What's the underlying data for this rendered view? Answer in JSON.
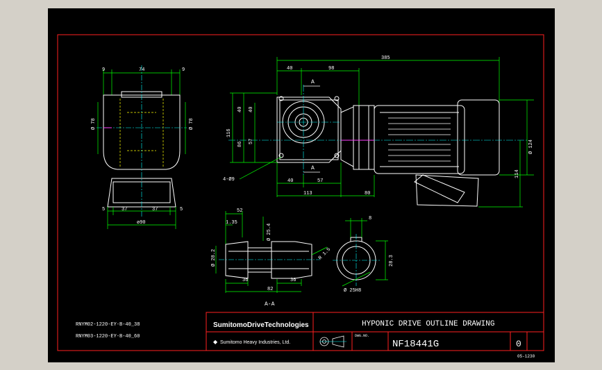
{
  "colors": {
    "frame": "#ff2020",
    "outline": "#ffffff",
    "dimension": "#00ff00",
    "centerline": "#00ffff",
    "hidden": "#ffff00",
    "text": "#ffffff",
    "magenta": "#ff40ff",
    "background": "#000000"
  },
  "left_view": {
    "dims_top": [
      "9",
      "74",
      "9"
    ],
    "dim_left": "Ø 78",
    "dim_right": "Ø 78",
    "dims_bottom": [
      "5",
      "37",
      "37",
      "5"
    ],
    "dim_base": "ø90"
  },
  "main_view": {
    "dim_overall": "385",
    "dims_top": [
      "40",
      "98"
    ],
    "section_mark_top": "A",
    "section_mark_bottom": "A",
    "dims_left": [
      "116",
      "40",
      "40",
      "86",
      "57"
    ],
    "hole_note": "4-Ø9",
    "dims_bottom": [
      "40",
      "57",
      "113",
      "80"
    ],
    "dim_motor_dia": "Ø 124",
    "dim_height": "114"
  },
  "section_view": {
    "dims_top": [
      "52",
      "1.35"
    ],
    "dim_bore": "Ø 25.4",
    "dim_left": "Ø 28.2",
    "dim_chamfer": "R 1.5",
    "dims_bottom": [
      "36",
      "36",
      "82"
    ],
    "caption": "A-A",
    "key_width": "8",
    "key_depth": "28.3",
    "shaft_dia": "Ø 25H8"
  },
  "notes": {
    "model_1": "RNYM02-1220-EY-B-40_38",
    "model_2": "RNYM03-1220-EY-B-40_60"
  },
  "title_block": {
    "brand": "SumitomoDriveTechnologies",
    "company": "Sumitomo Heavy Industries, Ltd.",
    "title": "HYPONIC DRIVE OUTLINE DRAWING",
    "drawing_no_label": "DWG.NO.",
    "drawing_no": "NF18441G",
    "revision": "0",
    "sheet_code": "05-1230"
  }
}
